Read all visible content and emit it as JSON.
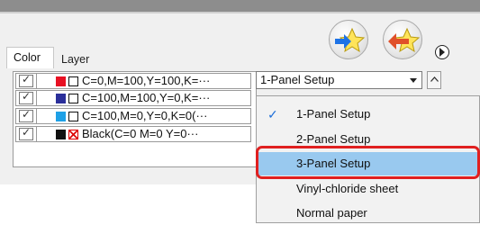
{
  "panel": {
    "tabs": [
      {
        "label": "Color"
      },
      {
        "label": "Layer"
      }
    ]
  },
  "colors": {
    "red": "#e81123",
    "navy": "#2b2f9a",
    "cyan": "#1ea0e6",
    "black": "#111111",
    "selection": "#99c9ef",
    "highlight": "#e02020"
  },
  "list": {
    "rows": [
      {
        "swatch": "red",
        "label": "C=0,M=100,Y=100,K=···"
      },
      {
        "swatch": "navy",
        "label": "C=100,M=100,Y=0,K=···"
      },
      {
        "swatch": "cyan",
        "label": "C=100,M=0,Y=0,K=0(···"
      },
      {
        "swatch": "black",
        "label": "Black(C=0 M=0 Y=0···"
      }
    ]
  },
  "combo": {
    "value": "1-Panel Setup"
  },
  "dropdown": {
    "options": [
      {
        "label": "1-Panel Setup",
        "checked": true
      },
      {
        "label": "2-Panel Setup"
      },
      {
        "label": "3-Panel Setup",
        "selected": true
      },
      {
        "label": "Vinyl-chloride sheet"
      },
      {
        "label": "Normal paper"
      }
    ]
  },
  "icons": {
    "action_1": "star-arrow-right-icon",
    "action_2": "star-arrow-left-icon",
    "play": "play-circle-icon"
  }
}
